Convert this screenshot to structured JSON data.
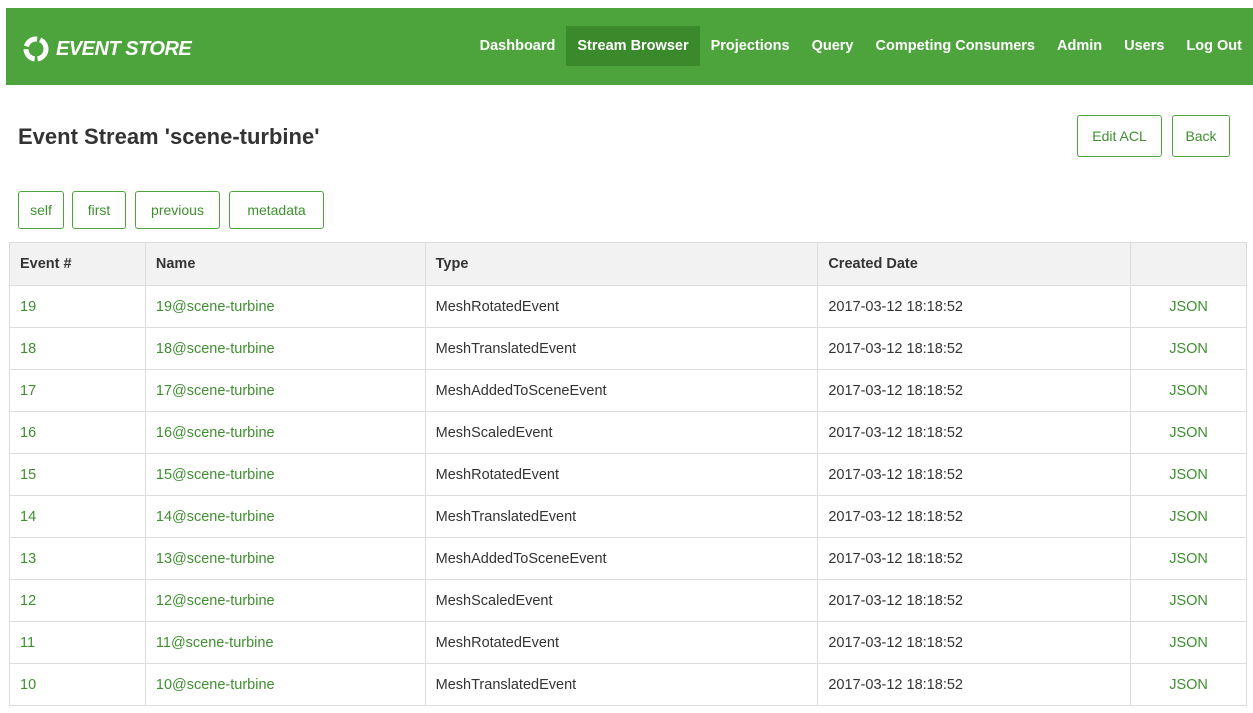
{
  "brand": {
    "text": "EVENT STORE"
  },
  "nav": {
    "items": [
      {
        "label": "Dashboard",
        "name": "nav-dashboard"
      },
      {
        "label": "Stream Browser",
        "name": "nav-stream-browser"
      },
      {
        "label": "Projections",
        "name": "nav-projections"
      },
      {
        "label": "Query",
        "name": "nav-query"
      },
      {
        "label": "Competing Consumers",
        "name": "nav-competing-consumers"
      },
      {
        "label": "Admin",
        "name": "nav-admin"
      },
      {
        "label": "Users",
        "name": "nav-users"
      },
      {
        "label": "Log Out",
        "name": "nav-log-out"
      }
    ],
    "active": "Stream Browser"
  },
  "page": {
    "title": "Event Stream 'scene-turbine'",
    "edit_acl": "Edit ACL",
    "back": "Back",
    "links": {
      "self": "self",
      "first": "first",
      "previous": "previous",
      "metadata": "metadata"
    }
  },
  "table": {
    "headers": [
      "Event #",
      "Name",
      "Type",
      "Created Date",
      ""
    ],
    "rows": [
      [
        "19",
        "19@scene-turbine",
        "MeshRotatedEvent",
        "2017-03-12 18:18:52",
        "JSON"
      ],
      [
        "18",
        "18@scene-turbine",
        "MeshTranslatedEvent",
        "2017-03-12 18:18:52",
        "JSON"
      ],
      [
        "17",
        "17@scene-turbine",
        "MeshAddedToSceneEvent",
        "2017-03-12 18:18:52",
        "JSON"
      ],
      [
        "16",
        "16@scene-turbine",
        "MeshScaledEvent",
        "2017-03-12 18:18:52",
        "JSON"
      ],
      [
        "15",
        "15@scene-turbine",
        "MeshRotatedEvent",
        "2017-03-12 18:18:52",
        "JSON"
      ],
      [
        "14",
        "14@scene-turbine",
        "MeshTranslatedEvent",
        "2017-03-12 18:18:52",
        "JSON"
      ],
      [
        "13",
        "13@scene-turbine",
        "MeshAddedToSceneEvent",
        "2017-03-12 18:18:52",
        "JSON"
      ],
      [
        "12",
        "12@scene-turbine",
        "MeshScaledEvent",
        "2017-03-12 18:18:52",
        "JSON"
      ],
      [
        "11",
        "11@scene-turbine",
        "MeshRotatedEvent",
        "2017-03-12 18:18:52",
        "JSON"
      ],
      [
        "10",
        "10@scene-turbine",
        "MeshTranslatedEvent",
        "2017-03-12 18:18:52",
        "JSON"
      ]
    ]
  },
  "colors": {
    "brand_green": "#4ea43c",
    "active_nav": "#3a8a2b",
    "link_green": "#3f8f30"
  },
  "icons": {
    "logo": "event-store-logo-icon"
  }
}
